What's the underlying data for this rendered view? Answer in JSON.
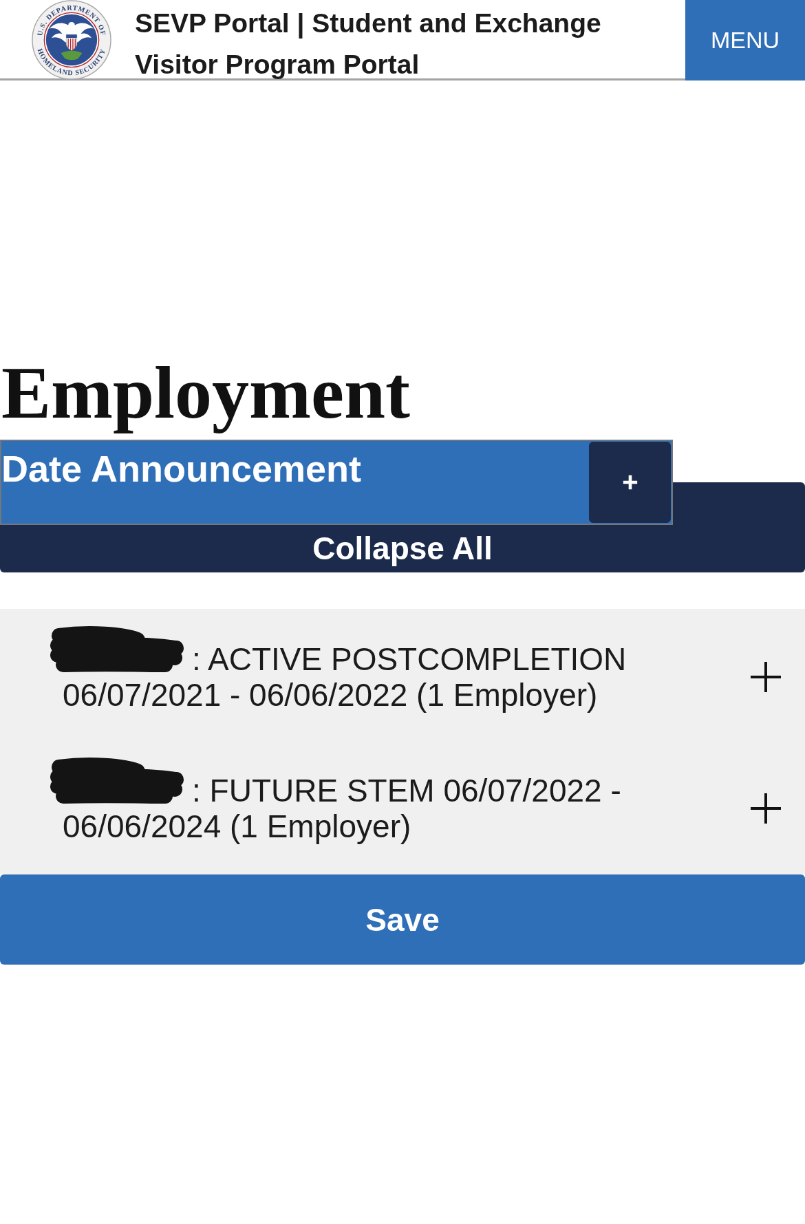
{
  "header": {
    "logo": {
      "top_text": "U.S. DEPARTMENT OF",
      "bottom_text": "HOMELAND SECURITY"
    },
    "title": "SEVP Portal | Student and Exchange Visitor Program Portal",
    "menu_button": "MENU"
  },
  "page_title": "Employment",
  "announcement": {
    "title": "Date Announcement",
    "expanded": false
  },
  "collapse_button": "Collapse All",
  "records": [
    {
      "label": ": ACTIVE POSTCOMPLETION 06/07/2021 - 06/06/2022 (1 Employer)",
      "redacted": true,
      "expanded": false
    },
    {
      "label": ": FUTURE STEM 06/07/2022 - 06/06/2024 (1 Employer)",
      "redacted": true,
      "expanded": false
    }
  ],
  "save_button": "Save"
}
